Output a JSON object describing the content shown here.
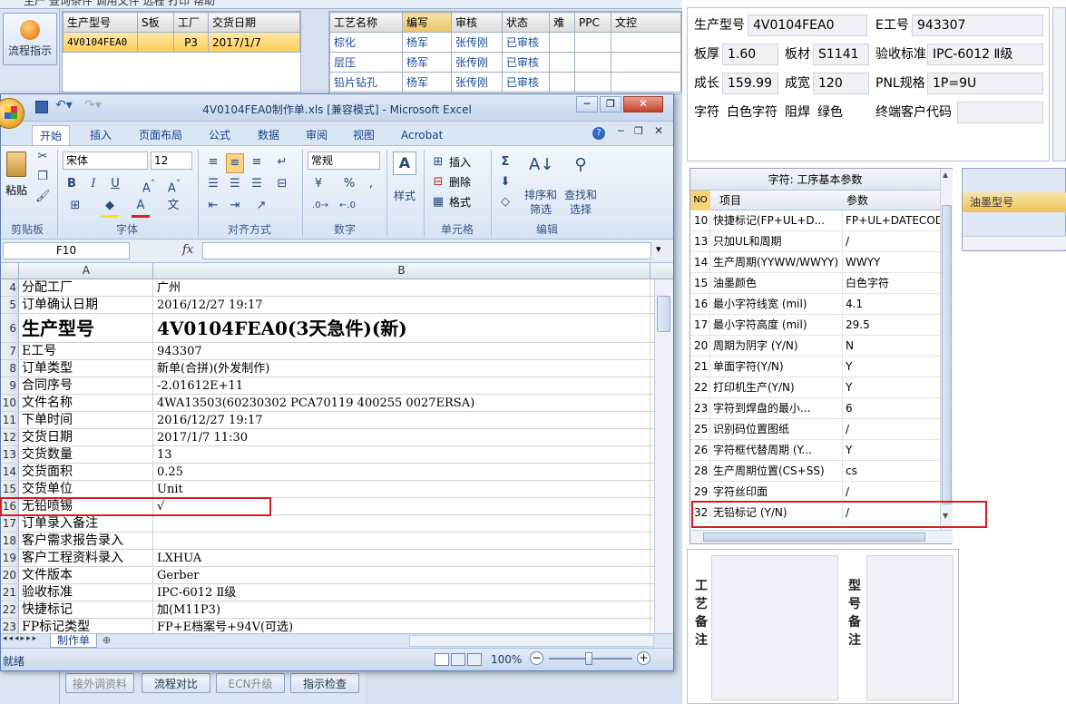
{
  "top_strip": {
    "cut_text": "生产   查询条件   调用文件   远程   打印   帮助"
  },
  "left_button": {
    "label": "流程指示"
  },
  "order_grid": {
    "headers": [
      "生产型号",
      "S板",
      "工厂",
      "交货日期"
    ],
    "row": [
      "4V0104FEA0",
      "",
      "P3",
      "2017/1/7"
    ]
  },
  "process_grid": {
    "headers": [
      "工艺名称",
      "编写",
      "审核",
      "状态",
      "难",
      "PPC",
      "文控"
    ],
    "rows": [
      [
        "棕化",
        "杨军",
        "张传刚",
        "已审核",
        "",
        "",
        ""
      ],
      [
        "层压",
        "杨军",
        "张传刚",
        "已审核",
        "",
        "",
        ""
      ],
      [
        "铅片钻孔",
        "杨军",
        "张传刚",
        "已审核",
        "",
        "",
        ""
      ]
    ]
  },
  "bottom_buttons": [
    "接外调资料",
    "流程对比",
    "ECN升级",
    "指示检查"
  ],
  "excel": {
    "title": "4V0104FEA0制作单.xls [兼容模式] - Microsoft Excel",
    "office_button": "Office",
    "tabs": [
      "开始",
      "插入",
      "页面布局",
      "公式",
      "数据",
      "审阅",
      "视图",
      "Acrobat"
    ],
    "ribbon": {
      "paste": "粘贴",
      "clipboard": "剪贴板",
      "font_name": "宋体",
      "font_size": "12",
      "font_group": "字体",
      "align_group": "对齐方式",
      "number_format": "常规",
      "number_group": "数字",
      "style": "样式",
      "insert": "插入",
      "delete": "删除",
      "format": "格式",
      "cells_group": "单元格",
      "sort_filter": "排序和筛选",
      "find_select": "查找和选择",
      "edit_group": "编辑"
    },
    "name_box": "F10",
    "fx": "fx",
    "col_a": "A",
    "col_b": "B",
    "rows": [
      {
        "n": "4",
        "a": "分配工厂",
        "b": "广州"
      },
      {
        "n": "5",
        "a": "订单确认日期",
        "b": "2016/12/27 19:17"
      },
      {
        "n": "6",
        "a": "生产型号",
        "b": "4V0104FEA0(3天急件)(新)"
      },
      {
        "n": "7",
        "a": "E工号",
        "b": "943307"
      },
      {
        "n": "8",
        "a": "订单类型",
        "b": "新单(合拼)(外发制作)"
      },
      {
        "n": "9",
        "a": "合同序号",
        "b": "-2.01612E+11"
      },
      {
        "n": "10",
        "a": "文件名称",
        "b": "4WA13503(60230302 PCA70119 400255 0027ERSA)"
      },
      {
        "n": "11",
        "a": "下单时间",
        "b": "2016/12/27 19:17"
      },
      {
        "n": "12",
        "a": "交货日期",
        "b": "2017/1/7 11:30"
      },
      {
        "n": "13",
        "a": "交货数量",
        "b": "13"
      },
      {
        "n": "14",
        "a": "交货面积",
        "b": "0.25"
      },
      {
        "n": "15",
        "a": "交货单位",
        "b": "Unit"
      },
      {
        "n": "16",
        "a": "无铅喷锡",
        "b": "√"
      },
      {
        "n": "17",
        "a": "订单录入备注",
        "b": ""
      },
      {
        "n": "18",
        "a": "客户需求报告录入",
        "b": ""
      },
      {
        "n": "19",
        "a": "客户工程资料录入",
        "b": "LXHUA"
      },
      {
        "n": "20",
        "a": "文件版本",
        "b": "Gerber"
      },
      {
        "n": "21",
        "a": "验收标准",
        "b": "IPC-6012 Ⅱ级"
      },
      {
        "n": "22",
        "a": "快捷标记",
        "b": "加(M11P3)"
      },
      {
        "n": "23",
        "a": "FP标记类型",
        "b": "FP+E档案号+94V(可选)"
      }
    ],
    "sheet_tab": "制作单",
    "status_ready": "就绪",
    "zoom": "100%"
  },
  "info": {
    "prod_model_label": "生产型号",
    "prod_model": "4V0104FEA0",
    "e_no_label": "E工号",
    "e_no": "943307",
    "thickness_label": "板厚",
    "thickness": "1.60",
    "material_label": "板材",
    "material": "S1141",
    "standard_label": "验收标准",
    "standard": "IPC-6012 Ⅱ级",
    "length_label": "成长",
    "length": "159.99",
    "width_label": "成宽",
    "width": "120",
    "pnl_label": "PNL规格",
    "pnl": "1P=9U",
    "char_label": "字符",
    "char": "白色字符",
    "solder_label": "阻焊",
    "solder": "绿色",
    "end_customer_label": "终端客户代码",
    "end_customer": ""
  },
  "params": {
    "title": "字符: 工序基本参数",
    "headers": [
      "NO",
      "项目",
      "参数"
    ],
    "rows": [
      {
        "no": "10",
        "item": "快捷标记(FP+UL+D...",
        "val": "FP+UL+DATECODE"
      },
      {
        "no": "13",
        "item": "只加UL和周期",
        "val": "/"
      },
      {
        "no": "14",
        "item": "生产周期(YYWW/WWYY)",
        "val": "WWYY"
      },
      {
        "no": "15",
        "item": "油墨颜色",
        "val": "白色字符"
      },
      {
        "no": "16",
        "item": "最小字符线宽 (mil)",
        "val": "4.1"
      },
      {
        "no": "17",
        "item": "最小字符高度 (mil)",
        "val": "29.5"
      },
      {
        "no": "20",
        "item": "周期为阴字 (Y/N)",
        "val": "N"
      },
      {
        "no": "21",
        "item": "单面字符(Y/N)",
        "val": "Y"
      },
      {
        "no": "22",
        "item": "打印机生产(Y/N)",
        "val": "Y"
      },
      {
        "no": "23",
        "item": "字符到焊盘的最小...",
        "val": "6"
      },
      {
        "no": "25",
        "item": "识别码位置图纸",
        "val": "/"
      },
      {
        "no": "26",
        "item": "字符框代替周期 (Y...",
        "val": "Y"
      },
      {
        "no": "28",
        "item": "生产周期位置(CS+SS)",
        "val": "cs"
      },
      {
        "no": "29",
        "item": "字符丝印面",
        "val": "/"
      },
      {
        "no": "32",
        "item": "无铅标记 (Y/N)",
        "val": "/"
      }
    ]
  },
  "ink": {
    "header": "油墨型号"
  },
  "remarks": {
    "process_label": "工艺备注",
    "model_label": "型号备注"
  }
}
